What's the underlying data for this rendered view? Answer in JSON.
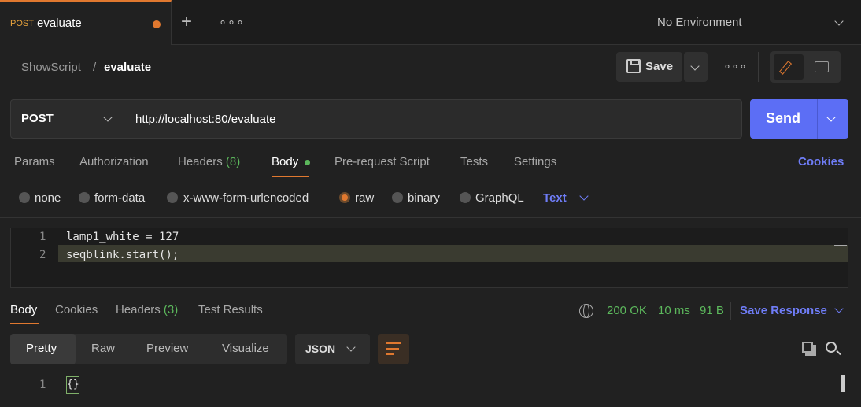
{
  "tab": {
    "method": "POST",
    "title": "evaluate",
    "new_tab_icon": "plus-icon",
    "more_icon": "ellipsis-icon"
  },
  "environment": {
    "label": "No Environment"
  },
  "breadcrumb": {
    "parent": "ShowScript",
    "separator": "/",
    "current": "evaluate"
  },
  "toolbar": {
    "save_label": "Save",
    "more": "∘∘∘"
  },
  "request": {
    "method": "POST",
    "url": "http://localhost:80/evaluate",
    "send_label": "Send"
  },
  "request_tabs": [
    {
      "label": "Params"
    },
    {
      "label": "Authorization"
    },
    {
      "label": "Headers",
      "count": "(8)"
    },
    {
      "label": "Body"
    },
    {
      "label": "Pre-request Script"
    },
    {
      "label": "Tests"
    },
    {
      "label": "Settings"
    }
  ],
  "cookies_label": "Cookies",
  "body_types": [
    {
      "label": "none",
      "selected": false
    },
    {
      "label": "form-data",
      "selected": false
    },
    {
      "label": "x-www-form-urlencoded",
      "selected": false
    },
    {
      "label": "raw",
      "selected": true
    },
    {
      "label": "binary",
      "selected": false
    },
    {
      "label": "GraphQL",
      "selected": false
    }
  ],
  "raw_format": "Text",
  "editor_lines": [
    {
      "num": "1",
      "code": "lamp1_white = 127"
    },
    {
      "num": "2",
      "code": "seqblink.start();"
    }
  ],
  "response_tabs": [
    {
      "label": "Body"
    },
    {
      "label": "Cookies"
    },
    {
      "label": "Headers",
      "count": "(3)"
    },
    {
      "label": "Test Results"
    }
  ],
  "response_status": {
    "status": "200 OK",
    "time": "10 ms",
    "size": "91 B"
  },
  "save_response_label": "Save Response",
  "view_modes": [
    {
      "label": "Pretty"
    },
    {
      "label": "Raw"
    },
    {
      "label": "Preview"
    },
    {
      "label": "Visualize"
    }
  ],
  "response_format": "JSON",
  "response_lines": [
    {
      "num": "1",
      "code": "{}"
    }
  ],
  "colors": {
    "accent": "#e0782f",
    "primary": "#5c6ef5",
    "success": "#5cb85c",
    "link": "#6f7df7"
  }
}
